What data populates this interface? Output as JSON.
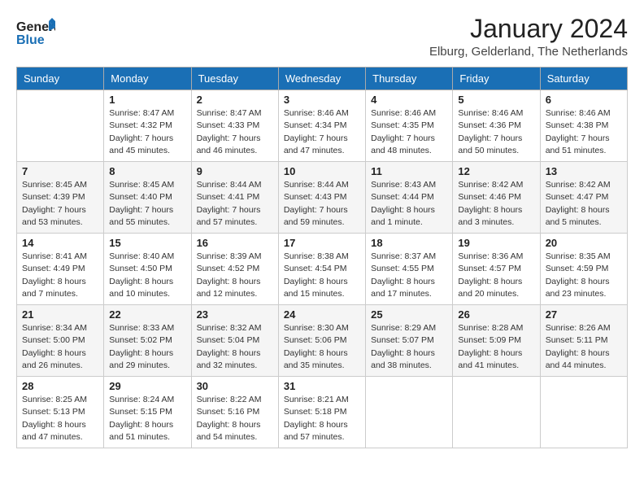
{
  "logo": {
    "line1": "General",
    "line2": "Blue",
    "icon": "▶"
  },
  "title": "January 2024",
  "subtitle": "Elburg, Gelderland, The Netherlands",
  "headers": [
    "Sunday",
    "Monday",
    "Tuesday",
    "Wednesday",
    "Thursday",
    "Friday",
    "Saturday"
  ],
  "weeks": [
    [
      {
        "num": "",
        "info": ""
      },
      {
        "num": "1",
        "info": "Sunrise: 8:47 AM\nSunset: 4:32 PM\nDaylight: 7 hours\nand 45 minutes."
      },
      {
        "num": "2",
        "info": "Sunrise: 8:47 AM\nSunset: 4:33 PM\nDaylight: 7 hours\nand 46 minutes."
      },
      {
        "num": "3",
        "info": "Sunrise: 8:46 AM\nSunset: 4:34 PM\nDaylight: 7 hours\nand 47 minutes."
      },
      {
        "num": "4",
        "info": "Sunrise: 8:46 AM\nSunset: 4:35 PM\nDaylight: 7 hours\nand 48 minutes."
      },
      {
        "num": "5",
        "info": "Sunrise: 8:46 AM\nSunset: 4:36 PM\nDaylight: 7 hours\nand 50 minutes."
      },
      {
        "num": "6",
        "info": "Sunrise: 8:46 AM\nSunset: 4:38 PM\nDaylight: 7 hours\nand 51 minutes."
      }
    ],
    [
      {
        "num": "7",
        "info": "Sunrise: 8:45 AM\nSunset: 4:39 PM\nDaylight: 7 hours\nand 53 minutes."
      },
      {
        "num": "8",
        "info": "Sunrise: 8:45 AM\nSunset: 4:40 PM\nDaylight: 7 hours\nand 55 minutes."
      },
      {
        "num": "9",
        "info": "Sunrise: 8:44 AM\nSunset: 4:41 PM\nDaylight: 7 hours\nand 57 minutes."
      },
      {
        "num": "10",
        "info": "Sunrise: 8:44 AM\nSunset: 4:43 PM\nDaylight: 7 hours\nand 59 minutes."
      },
      {
        "num": "11",
        "info": "Sunrise: 8:43 AM\nSunset: 4:44 PM\nDaylight: 8 hours\nand 1 minute."
      },
      {
        "num": "12",
        "info": "Sunrise: 8:42 AM\nSunset: 4:46 PM\nDaylight: 8 hours\nand 3 minutes."
      },
      {
        "num": "13",
        "info": "Sunrise: 8:42 AM\nSunset: 4:47 PM\nDaylight: 8 hours\nand 5 minutes."
      }
    ],
    [
      {
        "num": "14",
        "info": "Sunrise: 8:41 AM\nSunset: 4:49 PM\nDaylight: 8 hours\nand 7 minutes."
      },
      {
        "num": "15",
        "info": "Sunrise: 8:40 AM\nSunset: 4:50 PM\nDaylight: 8 hours\nand 10 minutes."
      },
      {
        "num": "16",
        "info": "Sunrise: 8:39 AM\nSunset: 4:52 PM\nDaylight: 8 hours\nand 12 minutes."
      },
      {
        "num": "17",
        "info": "Sunrise: 8:38 AM\nSunset: 4:54 PM\nDaylight: 8 hours\nand 15 minutes."
      },
      {
        "num": "18",
        "info": "Sunrise: 8:37 AM\nSunset: 4:55 PM\nDaylight: 8 hours\nand 17 minutes."
      },
      {
        "num": "19",
        "info": "Sunrise: 8:36 AM\nSunset: 4:57 PM\nDaylight: 8 hours\nand 20 minutes."
      },
      {
        "num": "20",
        "info": "Sunrise: 8:35 AM\nSunset: 4:59 PM\nDaylight: 8 hours\nand 23 minutes."
      }
    ],
    [
      {
        "num": "21",
        "info": "Sunrise: 8:34 AM\nSunset: 5:00 PM\nDaylight: 8 hours\nand 26 minutes."
      },
      {
        "num": "22",
        "info": "Sunrise: 8:33 AM\nSunset: 5:02 PM\nDaylight: 8 hours\nand 29 minutes."
      },
      {
        "num": "23",
        "info": "Sunrise: 8:32 AM\nSunset: 5:04 PM\nDaylight: 8 hours\nand 32 minutes."
      },
      {
        "num": "24",
        "info": "Sunrise: 8:30 AM\nSunset: 5:06 PM\nDaylight: 8 hours\nand 35 minutes."
      },
      {
        "num": "25",
        "info": "Sunrise: 8:29 AM\nSunset: 5:07 PM\nDaylight: 8 hours\nand 38 minutes."
      },
      {
        "num": "26",
        "info": "Sunrise: 8:28 AM\nSunset: 5:09 PM\nDaylight: 8 hours\nand 41 minutes."
      },
      {
        "num": "27",
        "info": "Sunrise: 8:26 AM\nSunset: 5:11 PM\nDaylight: 8 hours\nand 44 minutes."
      }
    ],
    [
      {
        "num": "28",
        "info": "Sunrise: 8:25 AM\nSunset: 5:13 PM\nDaylight: 8 hours\nand 47 minutes."
      },
      {
        "num": "29",
        "info": "Sunrise: 8:24 AM\nSunset: 5:15 PM\nDaylight: 8 hours\nand 51 minutes."
      },
      {
        "num": "30",
        "info": "Sunrise: 8:22 AM\nSunset: 5:16 PM\nDaylight: 8 hours\nand 54 minutes."
      },
      {
        "num": "31",
        "info": "Sunrise: 8:21 AM\nSunset: 5:18 PM\nDaylight: 8 hours\nand 57 minutes."
      },
      {
        "num": "",
        "info": ""
      },
      {
        "num": "",
        "info": ""
      },
      {
        "num": "",
        "info": ""
      }
    ]
  ]
}
